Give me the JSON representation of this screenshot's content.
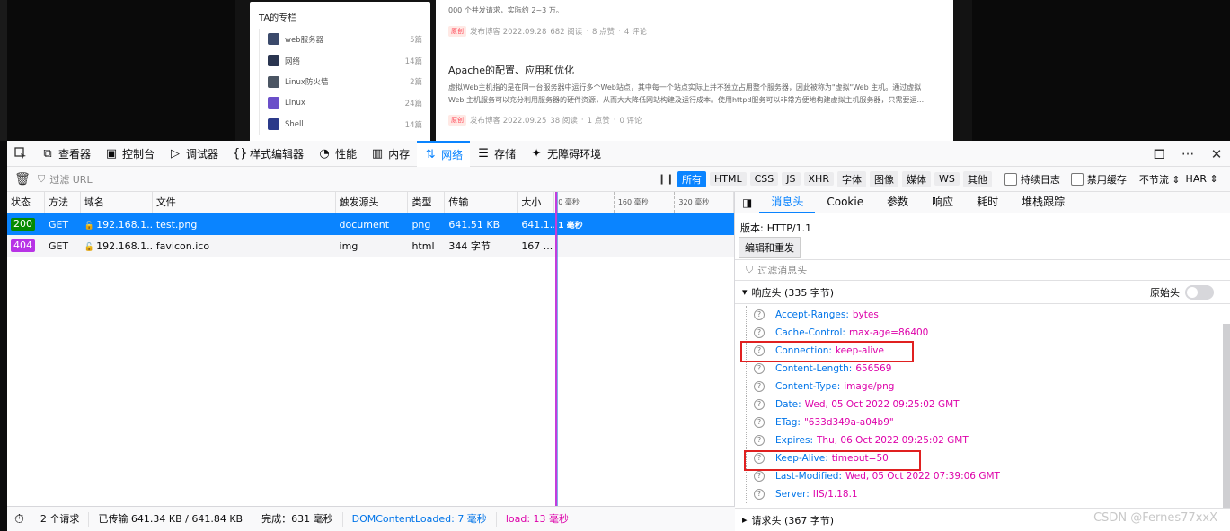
{
  "webpage": {
    "column_title": "TA的专栏",
    "columns": [
      {
        "name": "web服务器",
        "count": "5篇",
        "color": "#3b4a6b"
      },
      {
        "name": "网络",
        "count": "14篇",
        "color": "#2a3550"
      },
      {
        "name": "Linux防火墙",
        "count": "2篇",
        "color": "#4b5563"
      },
      {
        "name": "Linux",
        "count": "24篇",
        "color": "#6a4fc9"
      },
      {
        "name": "Shell",
        "count": "14篇",
        "color": "#2b3a8a"
      }
    ],
    "article1_snippet_end": "000 个并发请求，实际约 2~3 万。",
    "article1_meta": {
      "badge": "原创",
      "published": "发布博客 2022.09.28",
      "reads": "682 阅读",
      "likes": "8 点赞",
      "comments": "4 评论"
    },
    "article2_title": "Apache的配置、应用和优化",
    "article2_line1": "虚拟Web主机指的是在同一台服务器中运行多个Web站点，其中每一个站点实际上并不独立占用整个服务器，因此被称为\"虚拟\"Web 主机。通过虚拟",
    "article2_line2": "Web 主机服务可以充分利用服务器的硬件资源，从而大大降低网站构建及运行成本。使用httpd服务可以非常方便地构建虚拟主机服务器，只需要运...",
    "article2_meta": {
      "badge": "原创",
      "published": "发布博客 2022.09.25",
      "reads": "38 阅读",
      "likes": "1 点赞",
      "comments": "0 评论"
    }
  },
  "devtools": {
    "tabs": [
      {
        "label": "查看器",
        "icon": "inspector-icon",
        "glyph": "⧉"
      },
      {
        "label": "控制台",
        "icon": "console-icon",
        "glyph": "▣"
      },
      {
        "label": "调试器",
        "icon": "debugger-icon",
        "glyph": "▷"
      },
      {
        "label": "样式编辑器",
        "icon": "style-editor-icon",
        "glyph": "{}"
      },
      {
        "label": "性能",
        "icon": "performance-icon",
        "glyph": "◔"
      },
      {
        "label": "内存",
        "icon": "memory-icon",
        "glyph": "▥"
      },
      {
        "label": "网络",
        "icon": "network-icon",
        "glyph": "⇅"
      },
      {
        "label": "存储",
        "icon": "storage-icon",
        "glyph": "☰"
      },
      {
        "label": "无障碍环境",
        "icon": "accessibility-icon",
        "glyph": "✦"
      }
    ],
    "active_tab": "网络",
    "filter_placeholder": "过滤 URL",
    "type_filters": [
      "所有",
      "HTML",
      "CSS",
      "JS",
      "XHR",
      "字体",
      "图像",
      "媒体",
      "WS",
      "其他"
    ],
    "active_type": "所有",
    "persist_logs": "持续日志",
    "disable_cache": "禁用缓存",
    "throttle": "不节流 ⇕",
    "har": "HAR ⇕",
    "columns": [
      "状态",
      "方法",
      "域名",
      "文件",
      "触发源头",
      "类型",
      "传输",
      "大小"
    ],
    "timeline_ticks": [
      "0 毫秒",
      "160 毫秒",
      "320 毫秒"
    ],
    "requests": [
      {
        "status": "200",
        "status_color": "#058b00",
        "method": "GET",
        "domain": "192.168.1...",
        "file": "test.png",
        "initiator": "document",
        "type": "png",
        "transferred": "641.51 KB",
        "size": "641.1...",
        "timing": "1 毫秒",
        "selected": true
      },
      {
        "status": "404",
        "status_color": "#b833e6",
        "method": "GET",
        "domain": "192.168.1...",
        "file": "favicon.ico",
        "initiator": "img",
        "type": "html",
        "transferred": "344 字节",
        "size": "167 ...",
        "timing": "",
        "selected": false
      }
    ],
    "status_bar": {
      "requests": "2 个请求",
      "transferred": "已传输 641.34 KB / 641.84 KB",
      "finish": "完成：631 毫秒",
      "dom_loaded": "DOMContentLoaded: 7 毫秒",
      "load": "load: 13 毫秒"
    },
    "detail_tabs": [
      "消息头",
      "Cookie",
      "参数",
      "响应",
      "耗时",
      "堆栈跟踪"
    ],
    "active_detail_tab": "消息头",
    "version_label": "版本:",
    "version_value": "HTTP/1.1",
    "resend_button": "编辑和重发",
    "filter_headers_placeholder": "过滤消息头",
    "response_headers_title": "响应头 (335 字节)",
    "raw_headers_label": "原始头",
    "response_headers": [
      {
        "name": "Accept-Ranges:",
        "value": "bytes"
      },
      {
        "name": "Cache-Control:",
        "value": "max-age=86400"
      },
      {
        "name": "Connection:",
        "value": "keep-alive"
      },
      {
        "name": "Content-Length:",
        "value": "656569"
      },
      {
        "name": "Content-Type:",
        "value": "image/png"
      },
      {
        "name": "Date:",
        "value": "Wed, 05 Oct 2022 09:25:02 GMT"
      },
      {
        "name": "ETag:",
        "value": "\"633d349a-a04b9\""
      },
      {
        "name": "Expires:",
        "value": "Thu, 06 Oct 2022 09:25:02 GMT"
      },
      {
        "name": "Keep-Alive:",
        "value": "timeout=50"
      },
      {
        "name": "Last-Modified:",
        "value": "Wed, 05 Oct 2022 07:39:06 GMT"
      },
      {
        "name": "Server:",
        "value": "IIS/1.18.1"
      }
    ],
    "request_headers_title": "请求头 (367 字节)",
    "watermark": "CSDN @Fernes77xxX"
  }
}
